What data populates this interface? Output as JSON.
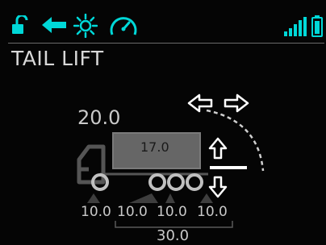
{
  "status_icons": [
    "lock-open-icon",
    "back-arrow-icon",
    "sun-icon",
    "gauge-icon",
    "signal-icon",
    "battery-icon"
  ],
  "colors": {
    "accent": "#00d8d8",
    "text": "#c9c9c9",
    "body_fill": "#666666",
    "background": "#050505"
  },
  "screen": {
    "title": "TAIL LIFT"
  },
  "vehicle": {
    "total_weight": "20.0",
    "body_weight": "17.0",
    "axle_weights": [
      "10.0",
      "10.0",
      "10.0",
      "10.0"
    ],
    "sum_weight": "30.0"
  },
  "controls": [
    "left-arrow-icon",
    "right-arrow-icon",
    "up-arrow-icon",
    "down-arrow-icon"
  ]
}
